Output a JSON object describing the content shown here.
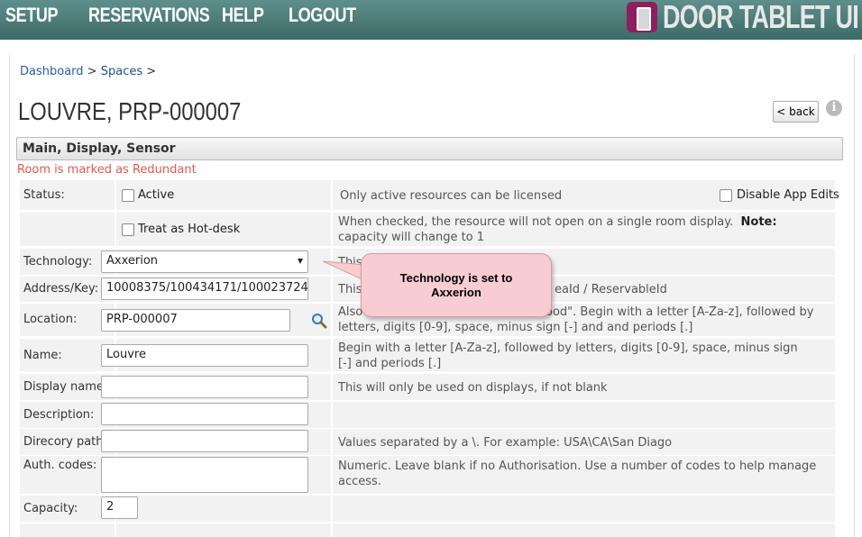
{
  "nav": {
    "items": [
      "SETUP",
      "RESERVATIONS",
      "HELP",
      "LOGOUT"
    ]
  },
  "brand": {
    "name": "DOOR TABLET UI",
    "icon": "door-tablet-logo-icon",
    "color": "#8d1f5e"
  },
  "breadcrumb": {
    "home": "Dashboard",
    "sep1": ">",
    "spaces": "Spaces",
    "sep2": ">"
  },
  "page": {
    "title": "LOUVRE, PRP-000007",
    "back_label": "< back",
    "info": "i"
  },
  "panel": {
    "title": "Main, Display, Sensor",
    "redundant_text": "Room is marked as Redundant"
  },
  "fields": {
    "status": {
      "label": "Status:",
      "active_label": "Active",
      "hint": "Only active resources can be licensed",
      "disable_app_edits": "Disable App Edits"
    },
    "hotdesk": {
      "label": "Treat as Hot-desk",
      "hint_prefix": "When checked, the resource will not open on a single room display.",
      "note_label": "Note:",
      "hint_suffix": "capacity will change to 1"
    },
    "technology": {
      "label": "Technology:",
      "value": "Axxerion",
      "hint": "This i"
    },
    "address": {
      "label": "Address/Key:",
      "value": "10008375/100434171/100023724",
      "hint_a": "This",
      "hint_b": "eaId / ReservableId"
    },
    "location": {
      "label": "Location:",
      "value": "PRP-000007",
      "hint_a": "Also",
      "hint_b": "ood\". Begin with a letter [A-Za-z], followed by letters, digits [0-9], space, minus sign [-] and and periods [.]"
    },
    "name": {
      "label": "Name:",
      "value": "Louvre",
      "hint": "Begin with a letter [A-Za-z], followed by letters, digits [0-9], space, minus sign [-] and periods [.]"
    },
    "display_name": {
      "label": "Display name:",
      "value": "",
      "hint": "This will only be used on displays, if not blank"
    },
    "description": {
      "label": "Description:",
      "value": ""
    },
    "directory": {
      "label": "Direcory path:",
      "value": "",
      "hint": "Values separated by a \\.  For example: USA\\CA\\San Diago"
    },
    "auth": {
      "label": "Auth. codes:",
      "value": "",
      "hint": "Numeric. Leave blank if no Authorisation. Use a number of codes to help manage access."
    },
    "capacity": {
      "label": "Capacity:",
      "value": "2"
    }
  },
  "callout": {
    "line1": "Technology is set to",
    "line2": "Axxerion"
  },
  "colors": {
    "topbar": "#4a7b78",
    "link": "#2a5d9f",
    "required": "#e07a2e",
    "redundant": "#e05a50",
    "callout": "#f7cdd2"
  }
}
